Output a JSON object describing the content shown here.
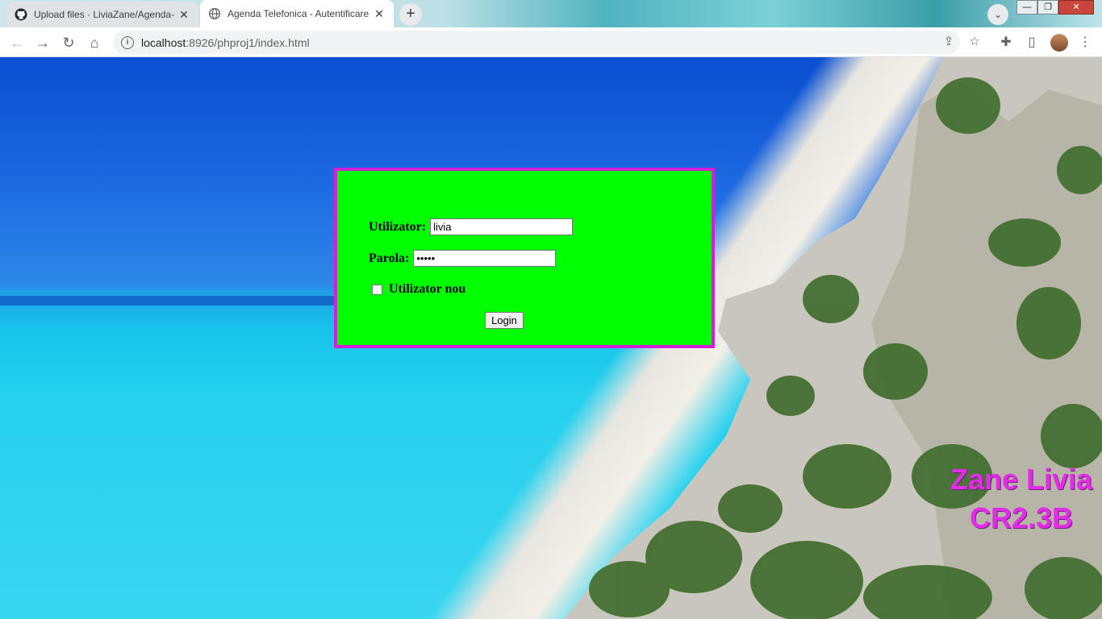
{
  "browser": {
    "tabs": [
      {
        "title": "Upload files · LiviaZane/Agenda-",
        "icon": "github-icon",
        "active": false
      },
      {
        "title": "Agenda Telefonica - Autentificare",
        "icon": "globe-icon",
        "active": true
      }
    ],
    "new_tab_label": "+",
    "address": {
      "host": "localhost",
      "path": ":8926/phproj1/index.html"
    },
    "window_controls": {
      "minimize": "—",
      "maximize": "❐",
      "close": "✕"
    }
  },
  "login": {
    "user_label": "Utilizator:",
    "user_value": "livia",
    "pass_label": "Parola:",
    "pass_value": "•••••",
    "new_user_label": "Utilizator nou",
    "new_user_checked": false,
    "login_button": "Login"
  },
  "watermark": {
    "line1": "Zane Livia",
    "line2": "CR2.3B"
  },
  "colors": {
    "form_background": "#00ff00",
    "form_border": "#d41fd9",
    "watermark": "#e22ce8"
  }
}
